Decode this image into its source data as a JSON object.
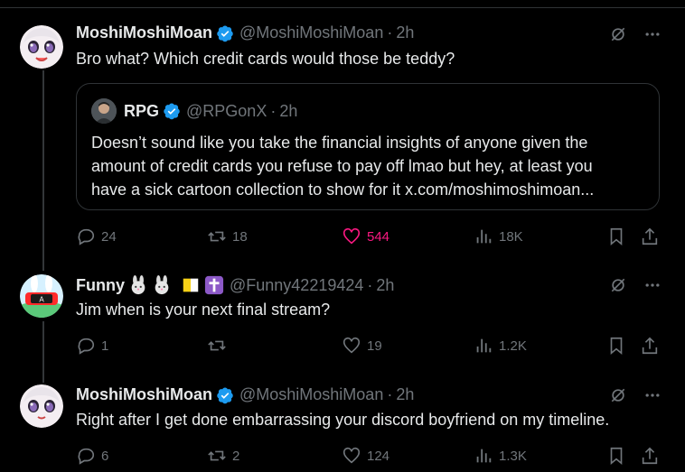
{
  "posts": [
    {
      "name": "MoshiMoshiMoan",
      "handle": "@MoshiMoshiMoan",
      "time": "2h",
      "text": "Bro what?  Which credit cards would those be teddy?",
      "replies": "24",
      "reposts": "18",
      "likes": "544",
      "views": "18K",
      "liked": true
    },
    {
      "name": "Funny",
      "handle": "@Funny42219424",
      "time": "2h",
      "text": "Jim when is your next final stream?",
      "replies": "1",
      "reposts": "",
      "likes": "19",
      "views": "1.2K"
    },
    {
      "name": "MoshiMoshiMoan",
      "handle": "@MoshiMoshiMoan",
      "time": "2h",
      "text": "Right after I get done embarrassing your discord boyfriend on my timeline.",
      "replies": "6",
      "reposts": "2",
      "likes": "124",
      "views": "1.3K"
    }
  ],
  "quote": {
    "name": "RPG",
    "handle": "@RPGonX",
    "time": "2h",
    "lines": [
      "Doesn’t sound like you take the financial insights of anyone given the",
      "amount of credit cards you refuse to pay off lmao but hey, at least you",
      "have a sick cartoon collection to show for it x.com/moshimoshimoan..."
    ]
  },
  "separator": "·",
  "colors": {
    "background": "#000000",
    "text": "#e7e9ea",
    "muted": "#71767b",
    "verified": "#1d9bf0",
    "like_active": "#f91880",
    "border": "#2f3336"
  },
  "icons": [
    "verified-badge-icon",
    "grok-icon",
    "more-icon",
    "reply-icon",
    "repost-icon",
    "like-icon",
    "views-icon",
    "bookmark-icon",
    "share-icon"
  ]
}
